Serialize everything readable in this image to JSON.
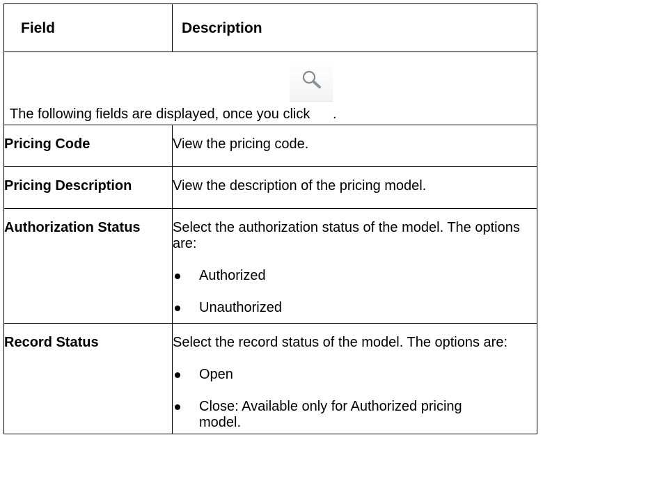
{
  "table": {
    "header": {
      "field": "Field",
      "description": "Description"
    },
    "intro": {
      "text": "The following fields are displayed, once you click",
      "period": ".",
      "icon": "search-icon"
    },
    "rows": [
      {
        "field": "Pricing Code",
        "description": "View the pricing code."
      },
      {
        "field": "Pricing Description",
        "description": "View the description of the pricing model."
      },
      {
        "field": "Authorization Status",
        "description": "Select the authorization status of the model. The options are:",
        "options": [
          "Authorized",
          "Unauthorized"
        ]
      },
      {
        "field": "Record Status",
        "description": "Select the record status of the model. The options are:",
        "options": [
          "Open",
          "Close: Available only for Authorized pricing model."
        ]
      }
    ]
  }
}
